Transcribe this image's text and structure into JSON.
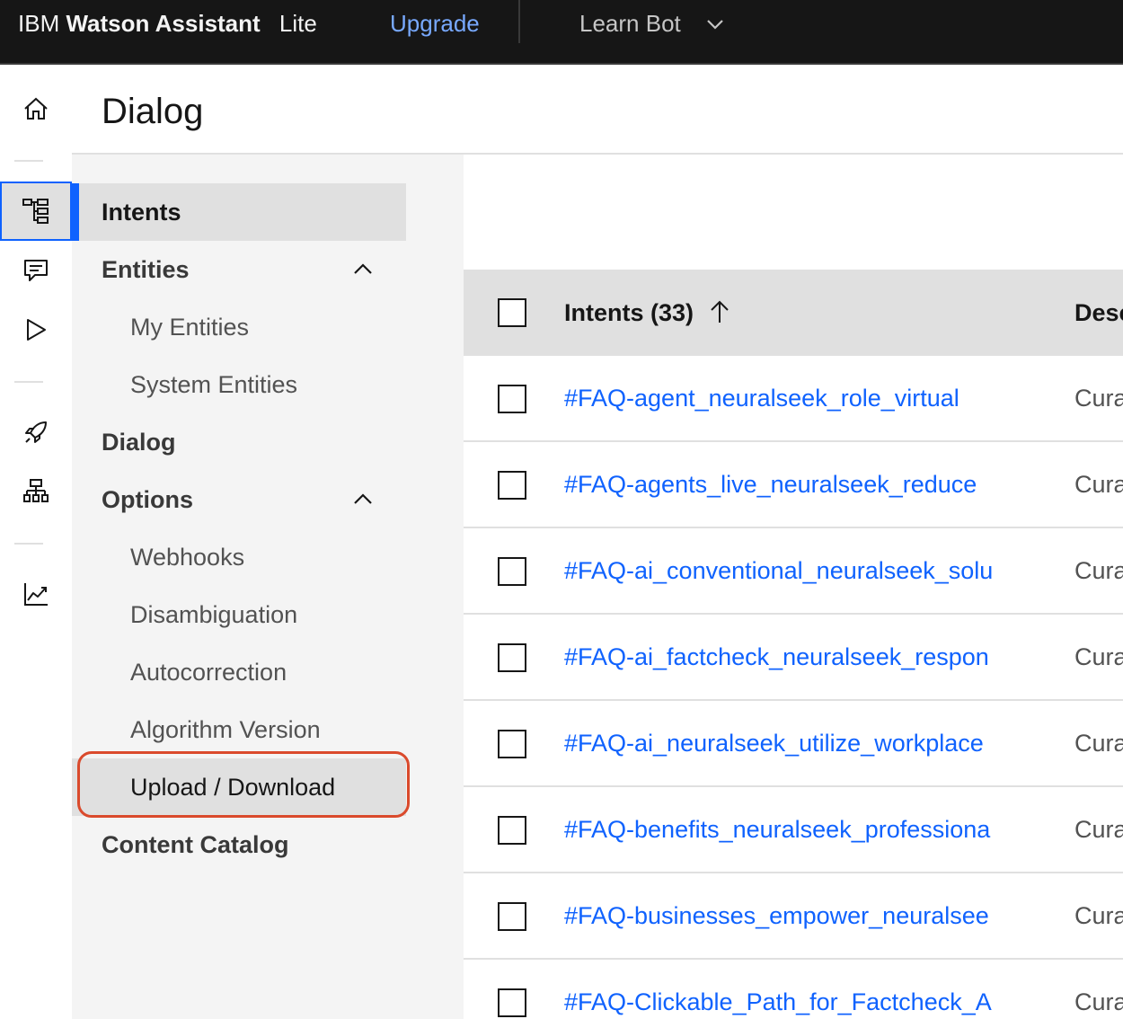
{
  "header": {
    "brand_prefix": "IBM",
    "brand_name": "Watson Assistant",
    "plan": "Lite",
    "upgrade_label": "Upgrade",
    "bot_name": "Learn Bot"
  },
  "rail": {
    "icons": [
      "home-icon",
      "tree-icon",
      "chat-icon",
      "play-icon",
      "rocket-icon",
      "hierarchy-icon",
      "analytics-icon"
    ],
    "active": "tree-icon"
  },
  "page": {
    "title": "Dialog"
  },
  "nav": {
    "intents": "Intents",
    "entities": "Entities",
    "my_entities": "My Entities",
    "system_entities": "System Entities",
    "dialog": "Dialog",
    "options": "Options",
    "webhooks": "Webhooks",
    "disambiguation": "Disambiguation",
    "autocorrection": "Autocorrection",
    "algorithm_version": "Algorithm Version",
    "upload_download": "Upload / Download",
    "content_catalog": "Content Catalog"
  },
  "table": {
    "col_intents": "Intents (33)",
    "col_description": "Desc",
    "rows": [
      {
        "intent": "#FAQ-agent_neuralseek_role_virtual",
        "description": "Cura"
      },
      {
        "intent": "#FAQ-agents_live_neuralseek_reduce",
        "description": "Cura"
      },
      {
        "intent": "#FAQ-ai_conventional_neuralseek_solu",
        "description": "Cura"
      },
      {
        "intent": "#FAQ-ai_factcheck_neuralseek_respon",
        "description": "Cura"
      },
      {
        "intent": "#FAQ-ai_neuralseek_utilize_workplace",
        "description": "Cura"
      },
      {
        "intent": "#FAQ-benefits_neuralseek_professiona",
        "description": "Cura"
      },
      {
        "intent": "#FAQ-businesses_empower_neuralsee",
        "description": "Cura"
      },
      {
        "intent": "#FAQ-Clickable_Path_for_Factcheck_A",
        "description": "Cura"
      }
    ]
  },
  "colors": {
    "header_bg": "#161616",
    "link": "#0f62fe",
    "upgrade": "#78a9ff",
    "active_indicator": "#0f62fe",
    "callout": "#da4a2c"
  }
}
